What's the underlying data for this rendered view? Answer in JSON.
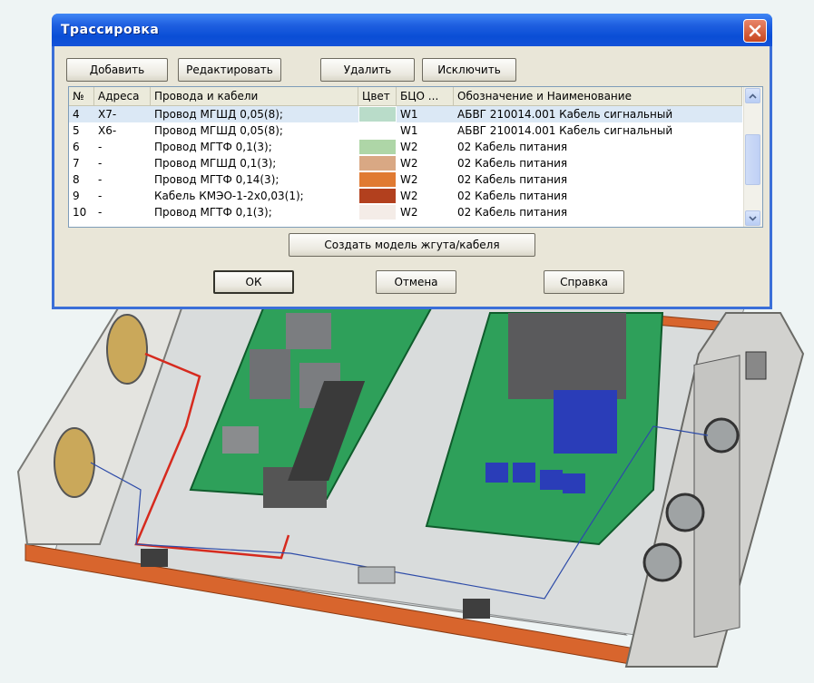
{
  "window": {
    "title": "Трассировка"
  },
  "toolbar": {
    "add_label": "Добавить",
    "edit_label": "Редактировать",
    "delete_label": "Удалить",
    "exclude_label": "Исключить"
  },
  "table": {
    "columns": [
      "№",
      "Адреса",
      "Провода и кабели",
      "Цвет",
      "БЦО ...",
      "Обозначение и Наименование"
    ],
    "rows": [
      {
        "no": "4",
        "addr": "X7-",
        "wire": "Провод МГШД 0,05(8);",
        "color": "#b9dcc9",
        "bco": "W1",
        "name": "АБВГ 210014.001 Кабель сигнальный",
        "selected": true
      },
      {
        "no": "5",
        "addr": "X6-",
        "wire": "Провод МГШД 0,05(8);",
        "color": "#ffffff",
        "bco": "W1",
        "name": "АБВГ 210014.001 Кабель сигнальный",
        "selected": false
      },
      {
        "no": "6",
        "addr": "-",
        "wire": "Провод МГТФ 0,1(3);",
        "color": "#aed6a7",
        "bco": "W2",
        "name": "02 Кабель питания",
        "selected": false
      },
      {
        "no": "7",
        "addr": "-",
        "wire": "Провод МГШД 0,1(3);",
        "color": "#d9a884",
        "bco": "W2",
        "name": "02 Кабель питания",
        "selected": false
      },
      {
        "no": "8",
        "addr": "-",
        "wire": "Провод МГТФ 0,14(3);",
        "color": "#e07a32",
        "bco": "W2",
        "name": "02 Кабель питания",
        "selected": false
      },
      {
        "no": "9",
        "addr": "-",
        "wire": "Кабель КМЭО-1-2х0,03(1);",
        "color": "#b2401e",
        "bco": "W2",
        "name": "02 Кабель питания",
        "selected": false
      },
      {
        "no": "10",
        "addr": "-",
        "wire": "Провод МГТФ 0,1(3);",
        "color": "#f4ece7",
        "bco": "W2",
        "name": "02 Кабель питания",
        "selected": false
      }
    ]
  },
  "actions": {
    "create_model_label": "Создать модель жгута/кабеля",
    "ok_label": "ОК",
    "cancel_label": "Отмена",
    "help_label": "Справка"
  },
  "colors": {
    "titlebar": "#0a4ed6",
    "pcb_green": "#2ea05a",
    "harness_red": "#d62a1e",
    "panel_orange": "#d8652d"
  }
}
